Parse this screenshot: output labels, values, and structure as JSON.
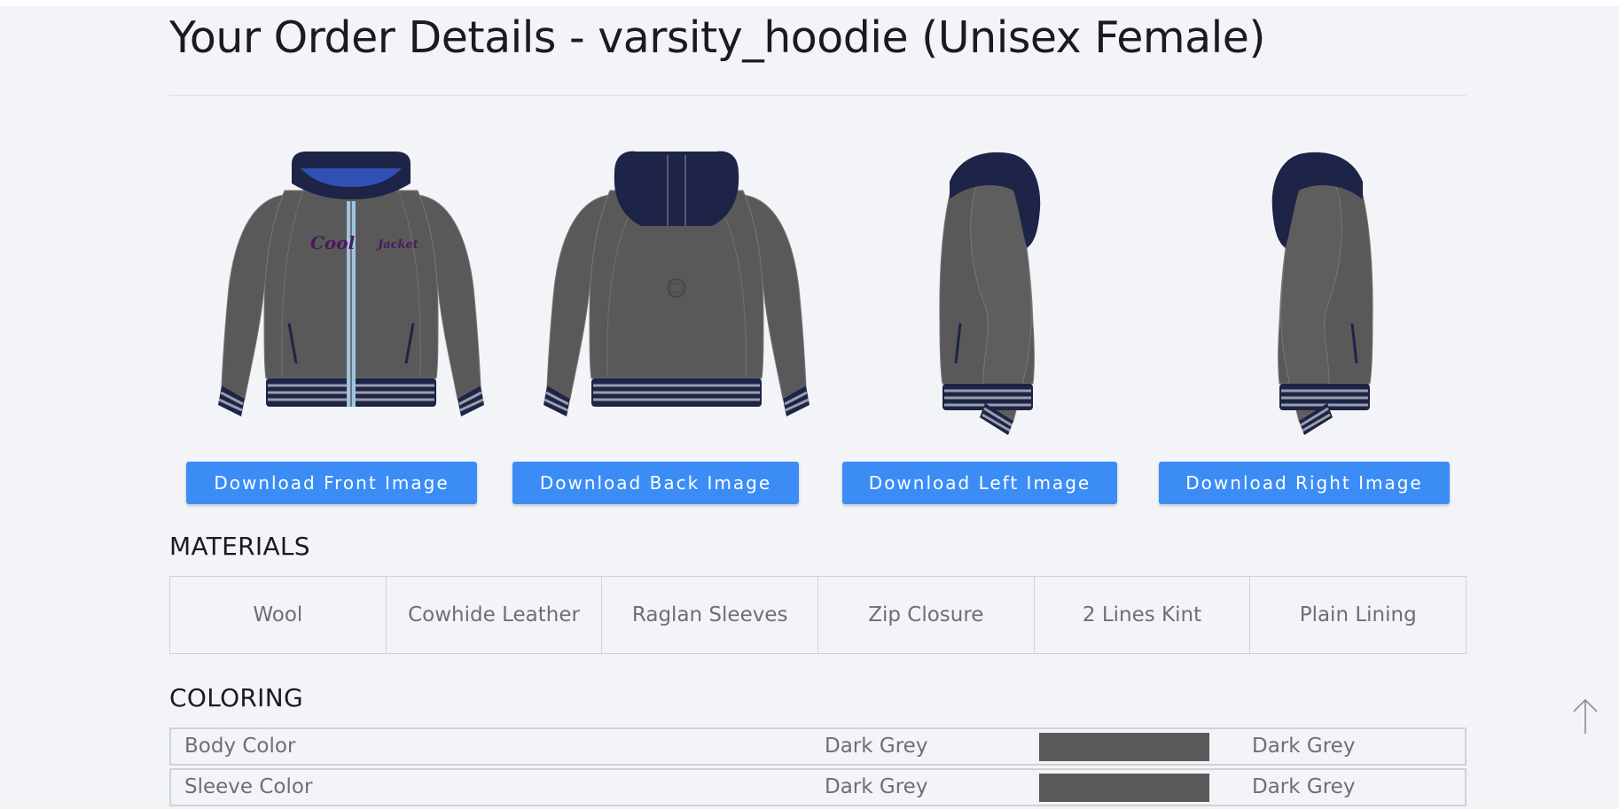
{
  "page": {
    "title": "Your Order Details - varsity_hoodie (Unisex Female)"
  },
  "downloads": [
    {
      "label": "Download Front Image"
    },
    {
      "label": "Download Back Image"
    },
    {
      "label": "Download Left Image"
    },
    {
      "label": "Download Right Image"
    }
  ],
  "jacket_text": {
    "left": "Cool",
    "right": "Jacket"
  },
  "materials": {
    "heading": "MATERIALS",
    "items": [
      "Wool",
      "Cowhide Leather",
      "Raglan Sleeves",
      "Zip Closure",
      "2 Lines Kint",
      "Plain Lining"
    ]
  },
  "coloring": {
    "heading": "COLORING",
    "rows": [
      {
        "label": "Body Color",
        "name": "Dark Grey",
        "swatch": "#595959",
        "value": "Dark Grey"
      },
      {
        "label": "Sleeve Color",
        "name": "Dark Grey",
        "swatch": "#595959",
        "value": "Dark Grey"
      }
    ]
  },
  "colors": {
    "body": "#595959",
    "hood": "#1d2447",
    "hood_lining": "#3150b5",
    "rib_stripe": "#9a9fa8",
    "zip": "#9fc4e0",
    "button": "#3b8df5",
    "lettering": "#4a1a5c"
  },
  "icons": {
    "scroll_top": "arrow-up-icon"
  }
}
